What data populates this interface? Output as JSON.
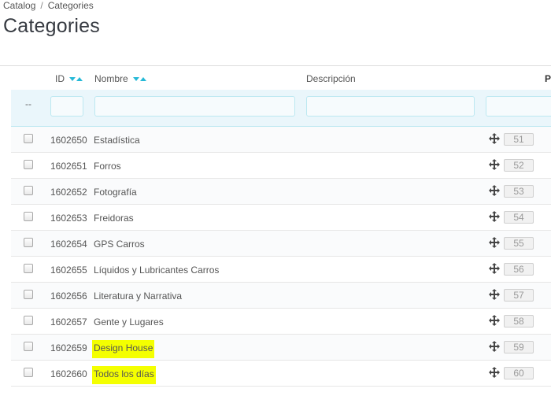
{
  "breadcrumb": {
    "parent": "Catalog",
    "separator": "/",
    "current": "Categories"
  },
  "page_title": "Categories",
  "table": {
    "columns": {
      "id": "ID",
      "name": "Nombre",
      "description": "Descripción",
      "position": "Po"
    },
    "filter_placeholder_dash": "--",
    "rows": [
      {
        "id": "1602650",
        "name": "Estadística",
        "position": "51",
        "highlighted": false
      },
      {
        "id": "1602651",
        "name": "Forros",
        "position": "52",
        "highlighted": false
      },
      {
        "id": "1602652",
        "name": "Fotografía",
        "position": "53",
        "highlighted": false
      },
      {
        "id": "1602653",
        "name": "Freidoras",
        "position": "54",
        "highlighted": false
      },
      {
        "id": "1602654",
        "name": "GPS Carros",
        "position": "55",
        "highlighted": false
      },
      {
        "id": "1602655",
        "name": "Líquidos y Lubricantes Carros",
        "position": "56",
        "highlighted": false
      },
      {
        "id": "1602656",
        "name": "Literatura y Narrativa",
        "position": "57",
        "highlighted": false
      },
      {
        "id": "1602657",
        "name": "Gente y Lugares",
        "position": "58",
        "highlighted": false
      },
      {
        "id": "1602659",
        "name": "Design House",
        "position": "59",
        "highlighted": true
      },
      {
        "id": "1602660",
        "name": "Todos los días",
        "position": "60",
        "highlighted": true
      }
    ]
  },
  "colors": {
    "accent": "#25b9d7",
    "highlight": "#f4ff00",
    "filter_bg": "#eaf6fb"
  },
  "icons": {
    "sort": "sort-asc-desc-icon",
    "move": "move-arrows-icon"
  }
}
